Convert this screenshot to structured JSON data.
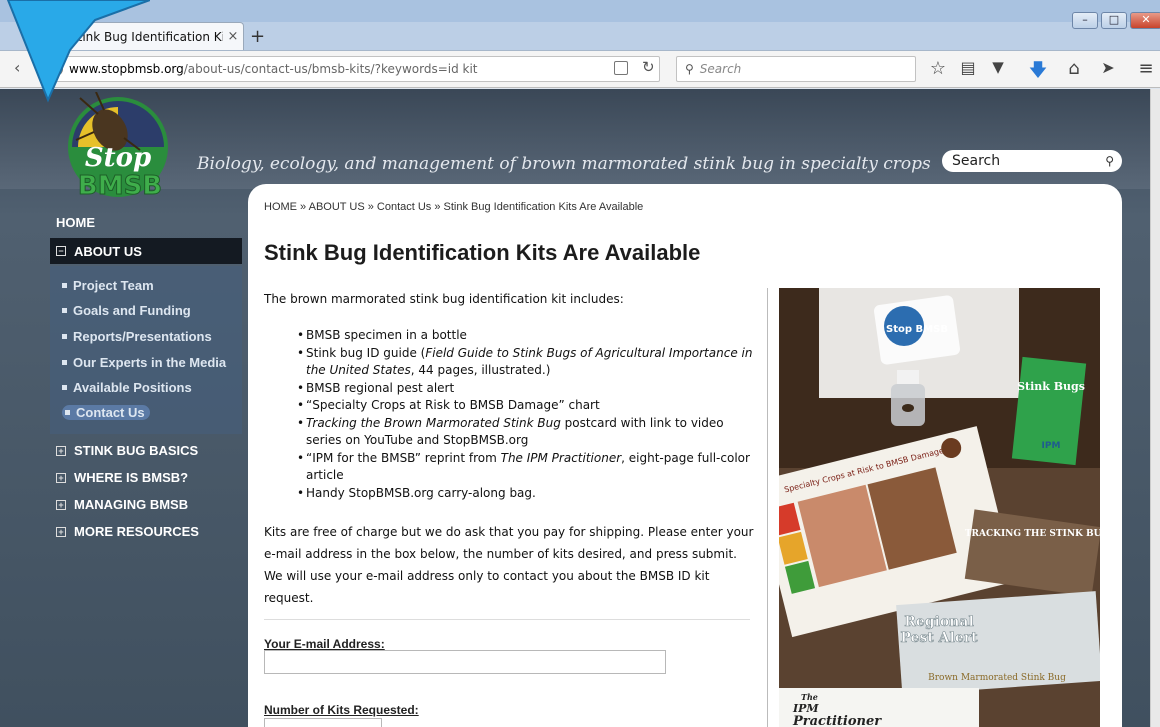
{
  "browser": {
    "tab_title": "Stink Bug Identification Kit...",
    "tab_close": "×",
    "new_tab": "+",
    "window_min": "–",
    "window_max": "□",
    "window_close": "✕",
    "url_host": "www.stopbmsb.org",
    "url_path": "/about-us/contact-us/bmsb-kits/?keywords=id kit",
    "search_placeholder": "Search",
    "toolbar_icons": [
      "bookmark-star-icon",
      "reading-list-icon",
      "pocket-icon",
      "download-icon",
      "home-icon",
      "share-icon",
      "menu-icon"
    ]
  },
  "site": {
    "logo_text_stop": "Stop",
    "logo_text_bmsb": "BMSB",
    "tagline": "Biology, ecology, and management of brown marmorated stink bug in specialty crops",
    "search_label": "Search"
  },
  "sidebar": {
    "home": "HOME",
    "about": "ABOUT US",
    "about_icon": "−",
    "sub_items": [
      "Project Team",
      "Goals and Funding",
      "Reports/Presentations",
      "Our Experts in the Media",
      "Available Positions",
      "Contact Us"
    ],
    "main_items": [
      "STINK BUG BASICS",
      "WHERE IS BMSB?",
      "MANAGING BMSB",
      "MORE RESOURCES"
    ],
    "main_icon": "+"
  },
  "content": {
    "breadcrumb": "HOME » ABOUT US » Contact Us » Stink Bug Identification Kits Are Available",
    "heading": "Stink Bug Identification Kits Are Available",
    "intro": "The brown marmorated stink bug identification kit includes:",
    "list": [
      {
        "before": "BMSB specimen in a bottle",
        "italic": "",
        "after": ""
      },
      {
        "before": "Stink bug ID guide (",
        "italic": "Field Guide to Stink Bugs of Agricultural Importance in the United States",
        "after": ", 44 pages, illustrated.)"
      },
      {
        "before": "BMSB regional pest alert",
        "italic": "",
        "after": ""
      },
      {
        "before": "“Specialty Crops at Risk to BMSB Damage” chart",
        "italic": "",
        "after": ""
      },
      {
        "before": "",
        "italic": "Tracking the Brown Marmorated Stink Bug",
        "after": " postcard with link to video series on YouTube and StopBMSB.org"
      },
      {
        "before": "“IPM for the BMSB” reprint from ",
        "italic": "The IPM Practitioner",
        "after": ", eight-page full-color article"
      },
      {
        "before": "Handy StopBMSB.org carry-along bag.",
        "italic": "",
        "after": ""
      }
    ],
    "paragraph": "Kits are free of charge but we do ask that you pay for shipping. Please enter your e-mail address in the box below, the number of kits desired, and press submit. We will use your e-mail address only to contact you about the BMSB ID kit request.",
    "email_label": "Your E-mail Address:",
    "kits_label": "Number of Kits Requested:"
  },
  "photo": {
    "card_logo": "Stop BMSB",
    "booklet_title": "Stink Bugs",
    "booklet_ipm": "IPM",
    "chart_title": "Specialty Crops at Risk to BMSB Damage",
    "postcard_title": "TRACKING THE STINK BUG",
    "alert_title_1": "Regional",
    "alert_title_2": "Pest Alert",
    "alert_subtitle": "Brown Marmorated Stink Bug",
    "practitioner_1": "The",
    "practitioner_2": "IPM",
    "practitioner_3": "Practitioner"
  },
  "colors": {
    "tab_strip": "#bccfe6",
    "page_bg": "#4a5867",
    "sidebar_active": "#141a22",
    "contact_highlight": "#5b7aa5",
    "cursor_fill": "#29a9e8"
  }
}
